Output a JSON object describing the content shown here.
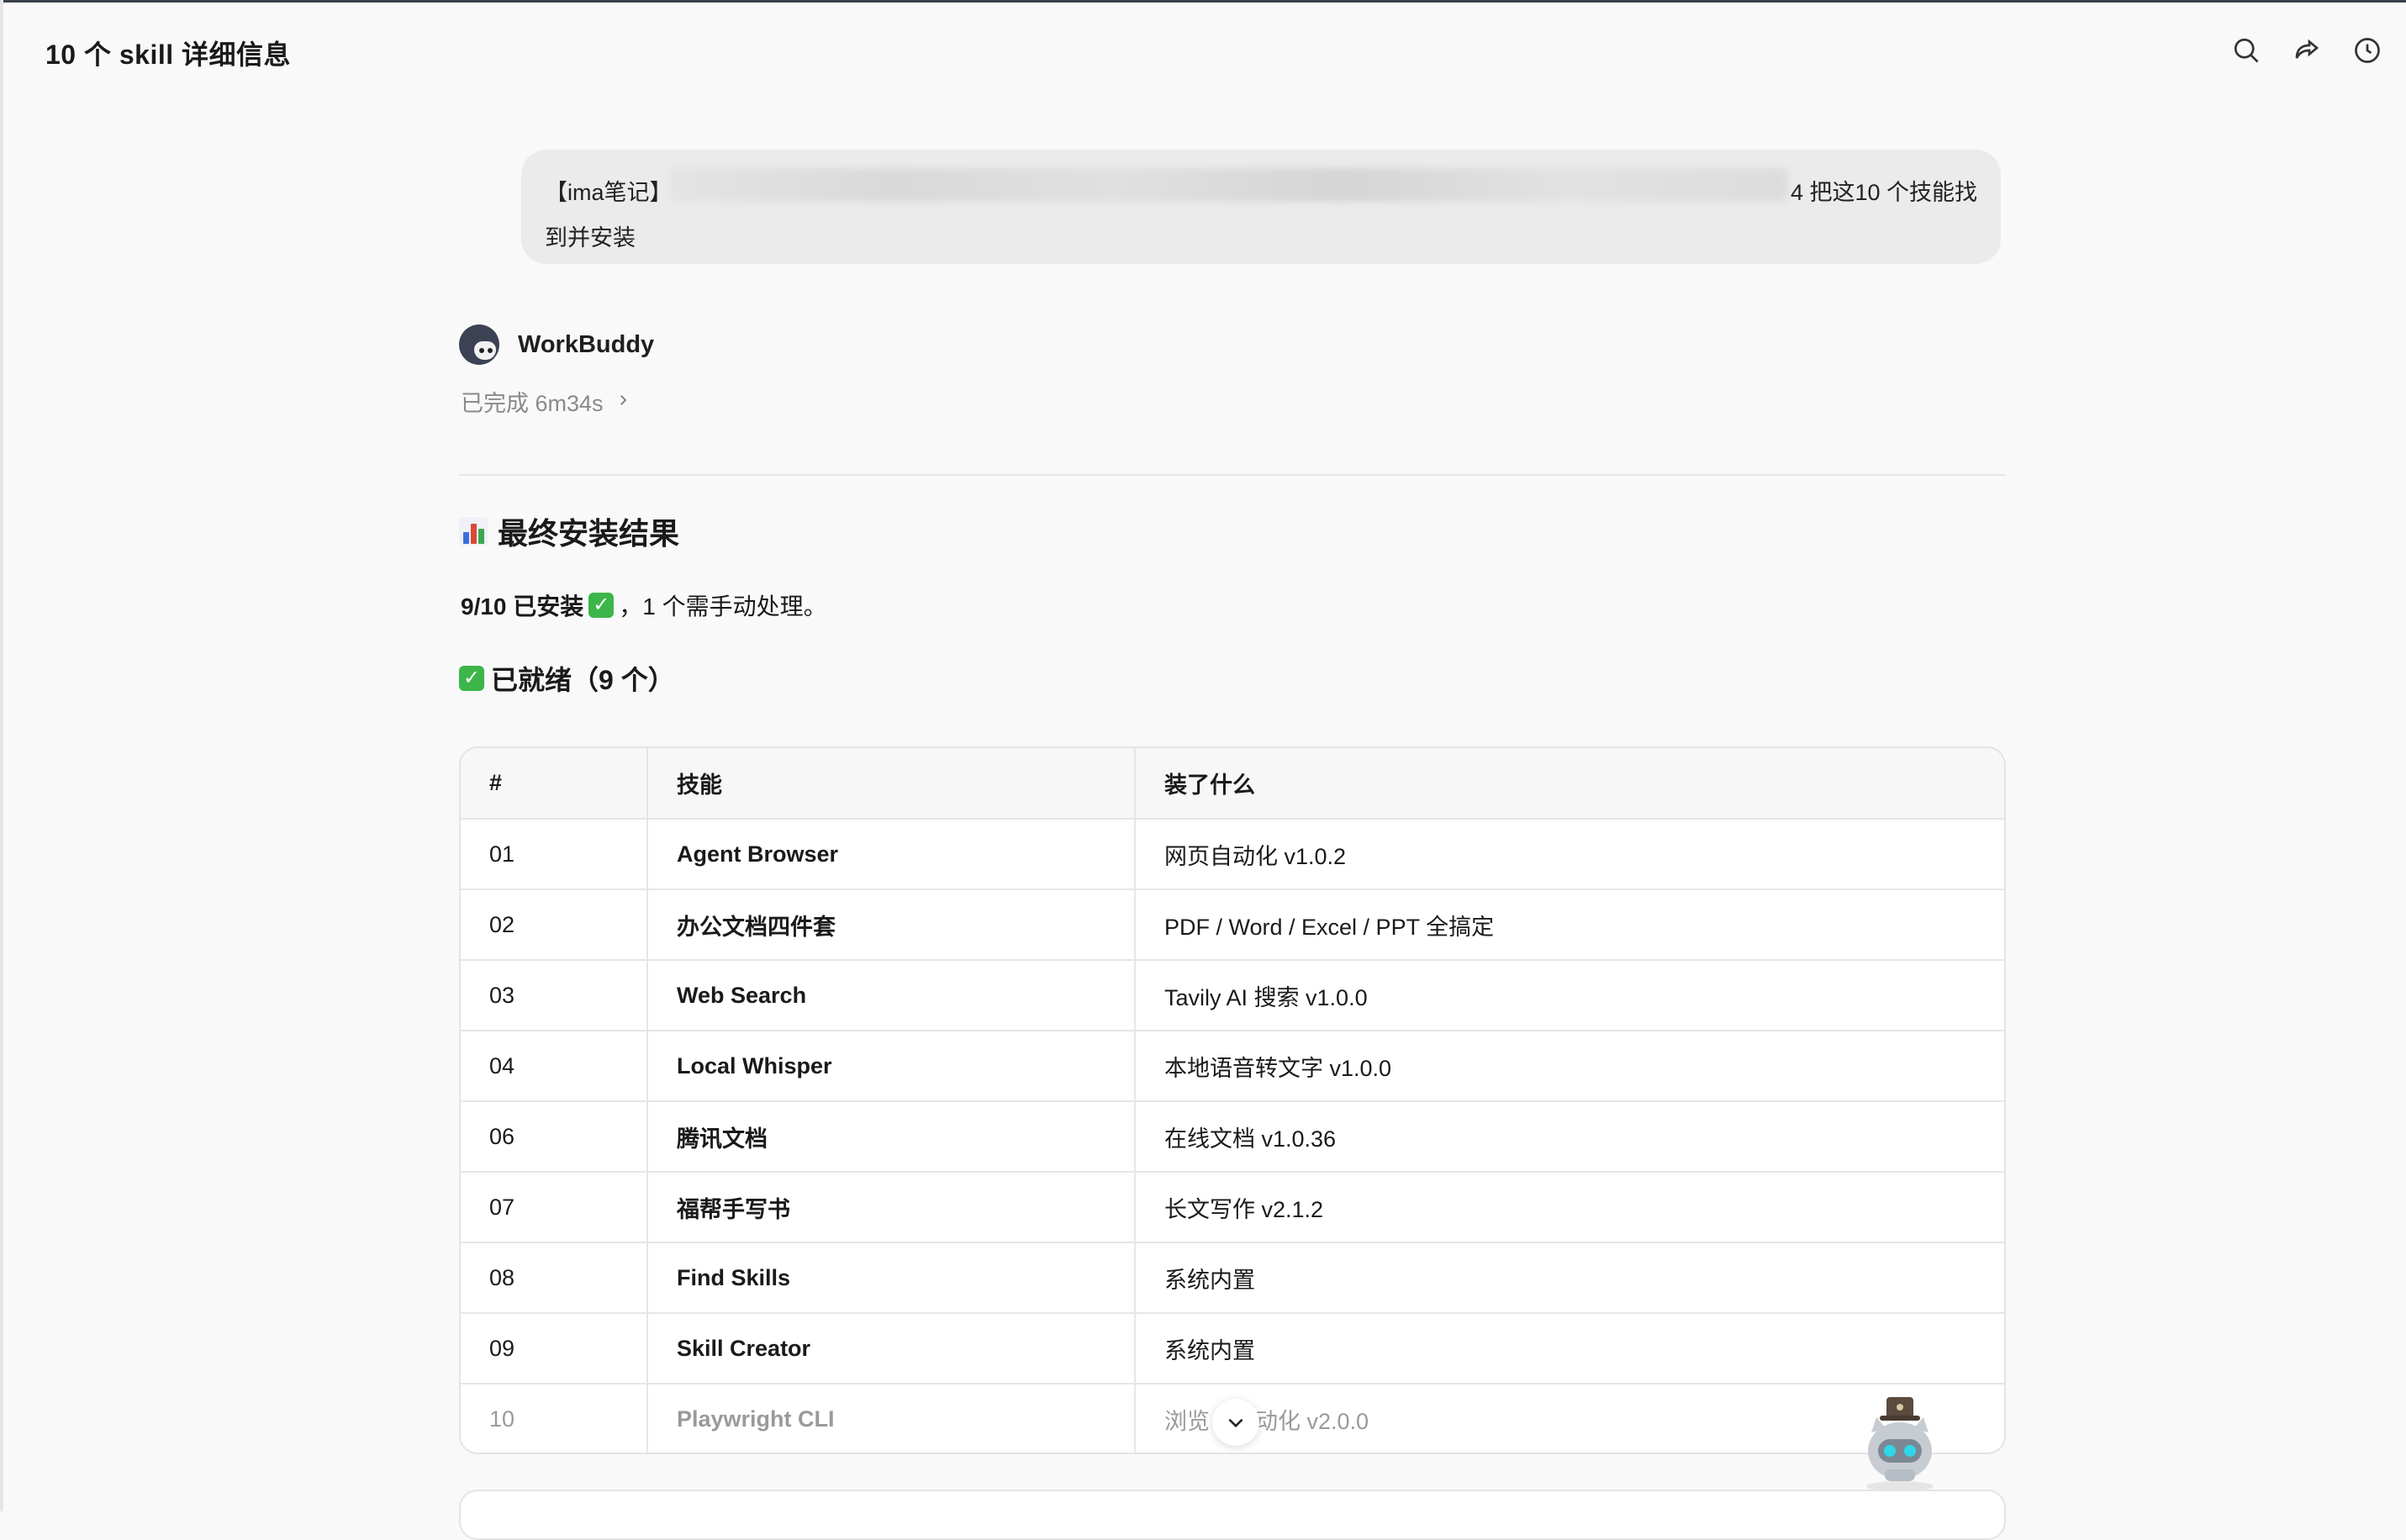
{
  "header": {
    "title": "10 个 skill 详细信息",
    "icons": [
      "search-icon",
      "share-icon",
      "history-icon",
      "panel-icon"
    ]
  },
  "user_message": {
    "prefix": "【ima笔记】",
    "suffix": "4 把这10 个技能找",
    "line2": "到并安装"
  },
  "agent": {
    "name": "WorkBuddy",
    "status": "已完成 6m34s"
  },
  "result": {
    "heading": "最终安装结果",
    "summary_bold": "9/10 已安装",
    "summary_rest": "，1 个需手动处理。",
    "ready_heading": "已就绪（9 个）"
  },
  "table": {
    "headers": [
      "#",
      "技能",
      "装了什么"
    ],
    "rows": [
      {
        "num": "01",
        "skill": "Agent Browser",
        "what": "网页自动化 v1.0.2"
      },
      {
        "num": "02",
        "skill": "办公文档四件套",
        "what": "PDF / Word / Excel / PPT 全搞定"
      },
      {
        "num": "03",
        "skill": "Web Search",
        "what": "Tavily AI 搜索 v1.0.0"
      },
      {
        "num": "04",
        "skill": "Local Whisper",
        "what": "本地语音转文字 v1.0.0"
      },
      {
        "num": "06",
        "skill": "腾讯文档",
        "what": "在线文档 v1.0.36"
      },
      {
        "num": "07",
        "skill": "福帮手写书",
        "what": "长文写作 v2.1.2"
      },
      {
        "num": "08",
        "skill": "Find Skills",
        "what": "系统内置"
      },
      {
        "num": "09",
        "skill": "Skill Creator",
        "what": "系统内置"
      },
      {
        "num": "10",
        "skill": "Playwright CLI",
        "what": "浏览　　动化 v2.0.0"
      }
    ]
  },
  "colors": {
    "check_green": "#3cb54a",
    "bubble_bg": "#ebebeb",
    "page_bg": "#f9f9f9"
  }
}
